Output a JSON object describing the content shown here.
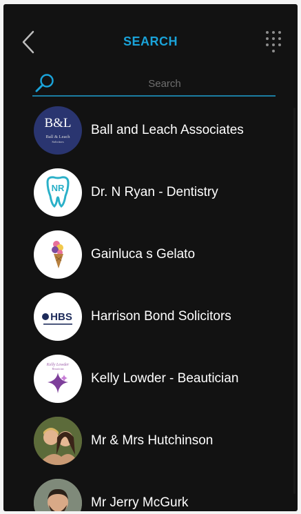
{
  "header": {
    "title": "SEARCH"
  },
  "search": {
    "placeholder": "Search",
    "value": ""
  },
  "contacts": [
    {
      "name": "Ball and Leach Associates",
      "logo_text": "B&L",
      "logo_sub": "Ball & Leach",
      "logo_sub2": "Solicitors"
    },
    {
      "name": "Dr. N Ryan - Dentistry",
      "logo_text": "NR"
    },
    {
      "name": "Gainluca s Gelato"
    },
    {
      "name": "Harrison Bond Solicitors",
      "logo_text": "HBS"
    },
    {
      "name": "Kelly Lowder - Beautician",
      "logo_text": "Kelly Lowder",
      "logo_sub": "Beautician"
    },
    {
      "name": "Mr & Mrs Hutchinson"
    },
    {
      "name": "Mr Jerry McGurk"
    }
  ],
  "colors": {
    "accent": "#1aa3d9",
    "background": "#121212",
    "text": "#ffffff"
  }
}
